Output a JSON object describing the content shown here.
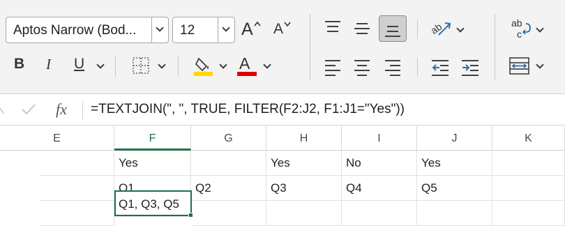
{
  "ribbon": {
    "font_name": "Aptos Narrow (Bod...",
    "font_size": "12",
    "increase_font_label": "A",
    "decrease_font_label": "A",
    "bold_label": "B",
    "italic_label": "I",
    "underline_label": "U",
    "fill_color": "#ffd800",
    "font_color": "#e00000",
    "wrap_text_icon": "ab-c-icon"
  },
  "formula_bar": {
    "fx_label": "fx",
    "formula": "=TEXTJOIN(\", \", TRUE, FILTER(F2:J2, F1:J1=\"Yes\"))"
  },
  "grid": {
    "columns": [
      "E",
      "F",
      "G",
      "H",
      "I",
      "J",
      "K"
    ],
    "selected_column": "F",
    "row1": [
      "",
      "Yes",
      "",
      "Yes",
      "No",
      "Yes",
      ""
    ],
    "row2": [
      "",
      "Q1",
      "Q2",
      "Q3",
      "Q4",
      "Q5",
      ""
    ],
    "row3": [
      "",
      "Q1, Q3, Q5",
      "",
      "",
      "",
      "",
      ""
    ],
    "active_cell_color": "#1e7145"
  }
}
